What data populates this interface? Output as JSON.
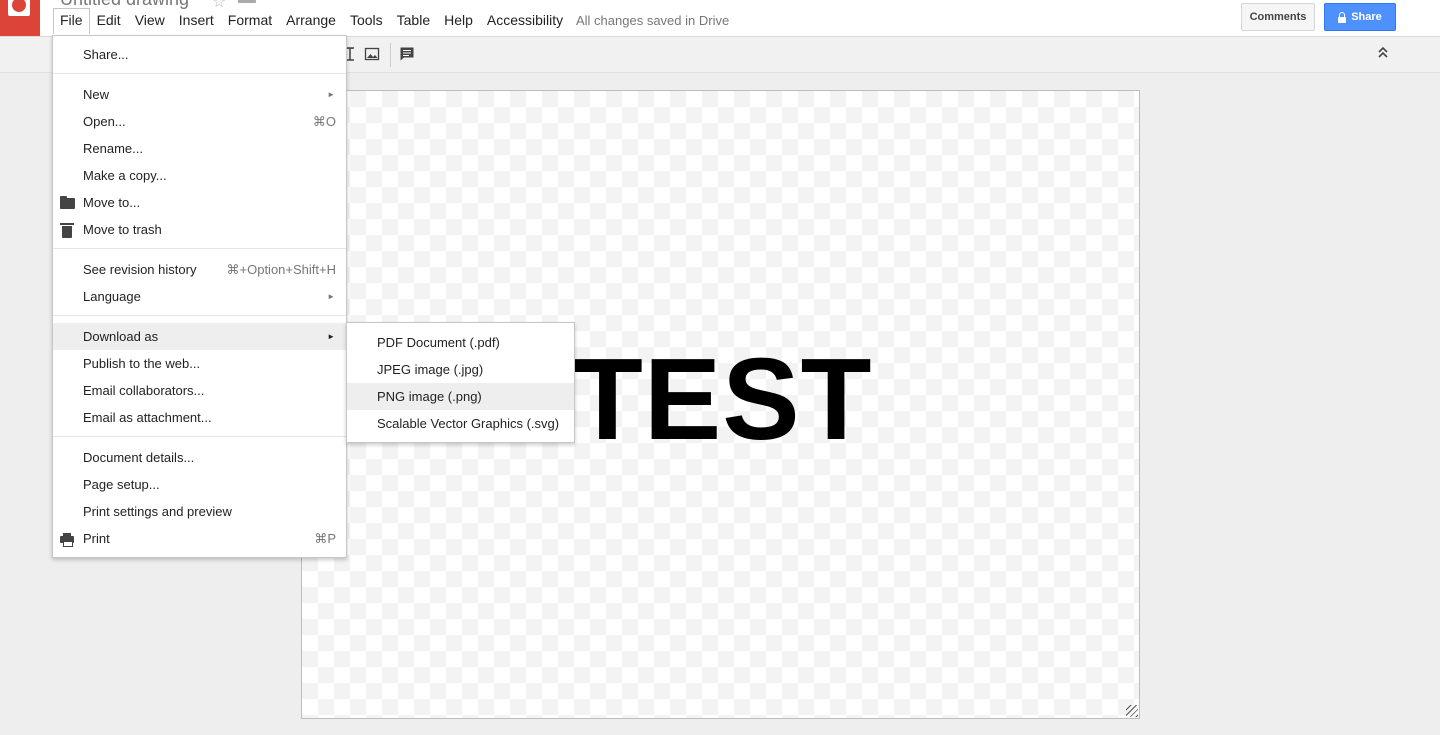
{
  "header": {
    "doc_title": "Untitled drawing",
    "save_status": "All changes saved in Drive",
    "comments_label": "Comments",
    "share_label": "Share"
  },
  "menubar": [
    "File",
    "Edit",
    "View",
    "Insert",
    "Format",
    "Arrange",
    "Tools",
    "Table",
    "Help",
    "Accessibility"
  ],
  "canvas": {
    "text": "TEST"
  },
  "file_menu": {
    "share": "Share...",
    "new": "New",
    "open": "Open...",
    "open_shortcut": "⌘O",
    "rename": "Rename...",
    "make_copy": "Make a copy...",
    "move_to": "Move to...",
    "move_to_trash": "Move to trash",
    "revision_history": "See revision history",
    "revision_shortcut": "⌘+Option+Shift+H",
    "language": "Language",
    "download_as": "Download as",
    "publish": "Publish to the web...",
    "email_collaborators": "Email collaborators...",
    "email_attachment": "Email as attachment...",
    "document_details": "Document details...",
    "page_setup": "Page setup...",
    "print_settings": "Print settings and preview",
    "print": "Print",
    "print_shortcut": "⌘P"
  },
  "download_submenu": [
    "PDF Document (.pdf)",
    "JPEG image (.jpg)",
    "PNG image (.png)",
    "Scalable Vector Graphics (.svg)"
  ],
  "colors": {
    "share_button": "#4d90fe",
    "logo": "#db4437"
  }
}
